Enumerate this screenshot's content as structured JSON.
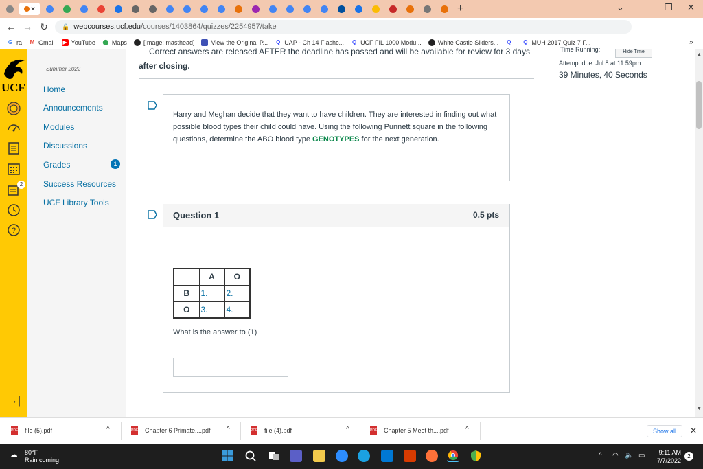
{
  "browser": {
    "url_host": "webcourses.ucf.edu",
    "url_path": "/courses/1403864/quizzes/2254957/take",
    "tab_close_glyph": "×",
    "new_tab_glyph": "+",
    "bookmarks": [
      {
        "label": "ra",
        "icon": "google-icon"
      },
      {
        "label": "Gmail",
        "icon": "gmail-icon"
      },
      {
        "label": "YouTube",
        "icon": "youtube-icon"
      },
      {
        "label": "Maps",
        "icon": "maps-icon"
      },
      {
        "label": "[Image: masthead]",
        "icon": "globe-icon"
      },
      {
        "label": "View the Original P...",
        "icon": "page-icon"
      },
      {
        "label": "UAP - Ch 14 Flashc...",
        "icon": "quizlet-icon"
      },
      {
        "label": "UCF FIL 1000 Modu...",
        "icon": "quizlet-icon"
      },
      {
        "label": "White Castle Sliders...",
        "icon": "globe-icon"
      },
      {
        "label": "",
        "icon": "quizlet-icon"
      },
      {
        "label": "MUH 2017 Quiz 7 F...",
        "icon": "quizlet-icon"
      }
    ],
    "more_bookmarks": "»",
    "profile_initial": "S"
  },
  "global_nav": {
    "logo_text": "UCF",
    "icons": [
      "account-icon",
      "dashboard-icon",
      "courses-icon",
      "calendar-icon",
      "inbox-icon",
      "history-icon",
      "help-icon"
    ],
    "inbox_count": "2",
    "collapse_glyph": "→|"
  },
  "course_nav": {
    "term": "Summer 2022",
    "items": [
      "Home",
      "Announcements",
      "Modules",
      "Discussions",
      "Grades",
      "Success Resources",
      "UCF Library Tools"
    ],
    "grades_badge": "1"
  },
  "quiz": {
    "notice_line1": "Correct answers are released AFTER the deadline has passed and will be available for review for 3 days",
    "notice_line2": "after closing.",
    "timer_label": "Time Running:",
    "hide_time": "Hide Time",
    "attempt_due": "Attempt due: Jul 8 at 11:59pm",
    "time_remaining": "39 Minutes, 40 Seconds",
    "intro_part1": "Harry and Meghan decide that they want to have children. They are interested in finding out what possible blood types their child could have. Using the following Punnett square in the following questions, determine the ABO blood type ",
    "intro_emphasis": "GENOTYPES",
    "intro_part2": " for the next generation.",
    "question_title": "Question 1",
    "question_points": "0.5 pts",
    "punnett": {
      "col_headers": [
        "A",
        "O"
      ],
      "rows": [
        {
          "header": "B",
          "cells": [
            "1.",
            "2."
          ]
        },
        {
          "header": "O",
          "cells": [
            "3.",
            "4."
          ]
        }
      ]
    },
    "question_text": "What is the answer to (1)",
    "answer_value": ""
  },
  "downloads": {
    "items": [
      "file (5).pdf",
      "Chapter 6 Primate....pdf",
      "file (4).pdf",
      "Chapter 5 Meet th....pdf"
    ],
    "show_all": "Show all",
    "close_glyph": "✕",
    "chevron": "^"
  },
  "taskbar": {
    "temperature": "80°F",
    "weather_text": "Rain coming",
    "time": "9:11 AM",
    "date": "7/7/2022",
    "notification_count": "2"
  }
}
